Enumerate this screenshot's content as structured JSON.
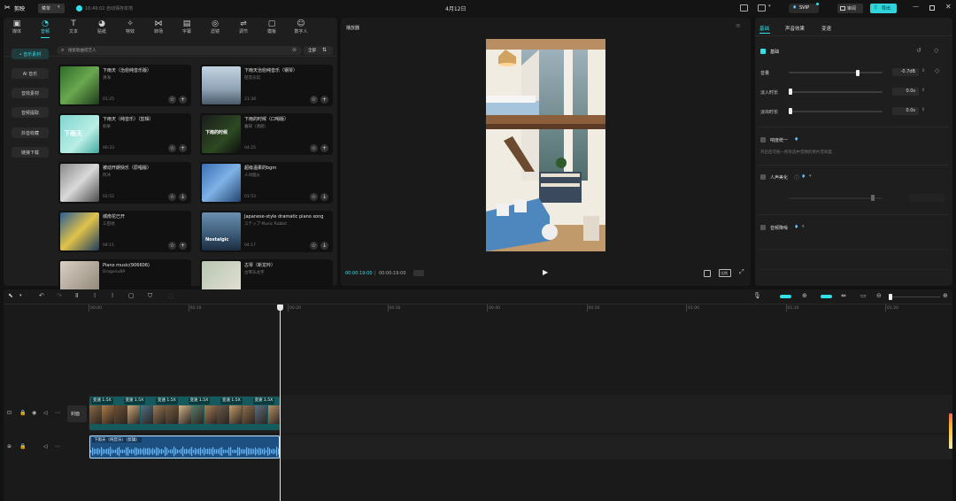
{
  "titlebar": {
    "app_name": "剪映",
    "menu_label": "菜单",
    "autosave": "16:49:02 自动保存本地",
    "project_title": "4月12日",
    "svip": "SVIP",
    "review": "审阅",
    "export": "导出"
  },
  "toolbar": {
    "items": [
      {
        "label": "媒体",
        "icon": "media-icon"
      },
      {
        "label": "音频",
        "icon": "audio-icon"
      },
      {
        "label": "文本",
        "icon": "text-icon"
      },
      {
        "label": "贴纸",
        "icon": "sticker-icon"
      },
      {
        "label": "特效",
        "icon": "effects-icon"
      },
      {
        "label": "转场",
        "icon": "transition-icon"
      },
      {
        "label": "字幕",
        "icon": "subtitle-icon"
      },
      {
        "label": "滤镜",
        "icon": "filter-icon"
      },
      {
        "label": "调节",
        "icon": "adjust-icon"
      },
      {
        "label": "模板",
        "icon": "template-icon"
      },
      {
        "label": "数字人",
        "icon": "avatar-icon"
      }
    ],
    "active_index": 1
  },
  "audio_categories": [
    "• 音乐素材",
    "AI 音乐",
    "音效素材",
    "音频提取",
    "抖音收藏",
    "链接下载"
  ],
  "search": {
    "placeholder": "搜索歌曲或艺人",
    "filter_label": "全部"
  },
  "music_cards": [
    {
      "title": "下雨天（治愈纯音乐版）",
      "artist": "清海",
      "duration": "01:25"
    },
    {
      "title": "下雨天治愈纯音乐（钢琴）",
      "artist": "轻音乐馆",
      "duration": "21:38"
    },
    {
      "title": "下雨天（纯音乐）（剪辑）",
      "artist": "如果",
      "duration": "00:33"
    },
    {
      "title": "下雨的时候（口哨版）",
      "artist": "暮辞（清颜）",
      "duration": "04:25"
    },
    {
      "title": "被动开朗快乐（原唱版）",
      "artist": "阿冰",
      "duration": "02:52"
    },
    {
      "title": "超级温柔的bgm",
      "artist": "人间烟火",
      "duration": "01:53"
    },
    {
      "title": "城南花已开",
      "artist": "三亩地",
      "duration": "04:11"
    },
    {
      "title": "Japanese-style dramatic piano song",
      "artist": "ステップ Music Rabbit",
      "duration": "04:17"
    },
    {
      "title": "Piano music(906606)",
      "artist": "Dragonu89",
      "duration": ""
    },
    {
      "title": "古琴（新龙吟）",
      "artist": "古琴乐龙字",
      "duration": ""
    }
  ],
  "card_thumb_texts": {
    "c2": "下雨天",
    "c3": "下雨的时候",
    "c7": "Nostalgic"
  },
  "player": {
    "title": "播放器",
    "current_time": "00:00:19:00",
    "total_time": "00:00:19:00",
    "ratio_label": "比例"
  },
  "properties": {
    "tabs": [
      "基础",
      "声音效果",
      "变速"
    ],
    "active_tab": 0,
    "section_basic": "基础",
    "volume_label": "音量",
    "volume_value": "-0.7dB",
    "fadein_label": "淡入时长",
    "fadein_value": "0.0s",
    "fadeout_label": "淡出时长",
    "fadeout_value": "0.0s",
    "loudness_label": "响度统一",
    "loudness_desc": "开启后可统一所有选中音频的原片音响度",
    "voice_enhance_label": "人声美化",
    "denoise_label": "音频降噪"
  },
  "timeline": {
    "ruler_ticks": [
      "00:00",
      "00:10",
      "00:20",
      "00:30",
      "00:40",
      "00:50",
      "01:00",
      "01:10",
      "01:20"
    ],
    "cover_label": "封面",
    "speed_labels": [
      "变速 1.5X",
      "变速 1.5X",
      "变速 1.5X",
      "变速 1.5X",
      "变速 1.5X",
      "变速 1.5X"
    ],
    "audio_clip_label": "下雨天（纯音乐）（剪辑）"
  },
  "colors": {
    "accent": "#2fe1e8",
    "video_track": "#155a5c",
    "audio_track": "#1d4f80",
    "playhead": "#e8e8e8"
  }
}
